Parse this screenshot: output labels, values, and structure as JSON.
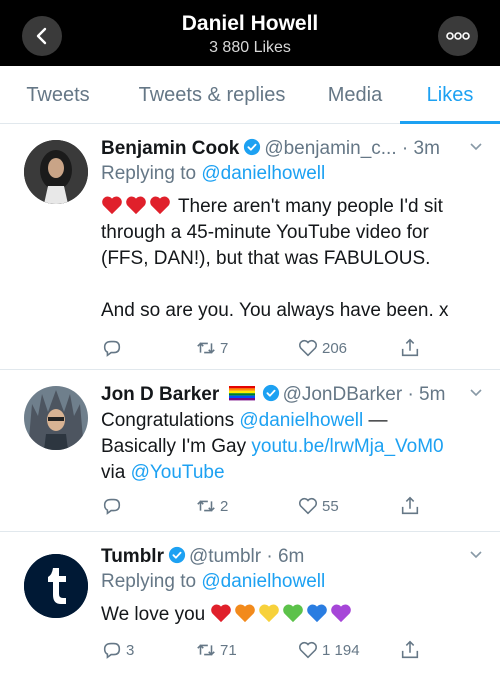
{
  "header": {
    "title": "Daniel Howell",
    "subtitle": "3 880 Likes",
    "back_icon": "chevron-left-icon",
    "more_icon": "more-dots-icon"
  },
  "tabs": [
    {
      "label": "Tweets",
      "active": false
    },
    {
      "label": "Tweets & replies",
      "active": false
    },
    {
      "label": "Media",
      "active": false
    },
    {
      "label": "Likes",
      "active": true
    }
  ],
  "colors": {
    "accent": "#1da1f2",
    "muted": "#657786",
    "heart_red": "#e0202b"
  },
  "tweets": [
    {
      "name": "Benjamin Cook",
      "handle": "@benjamin_c...",
      "time": "· 3m",
      "reply_prefix": "Replying to",
      "reply_to": "@danielhowell",
      "text_lines": [
        "There aren't many people I'd sit",
        "through a 45-minute YouTube video for",
        "(FFS, DAN!), but that was FABULOUS."
      ],
      "text_line2": "And so are you. You always have been. x",
      "retweets": "7",
      "likes": "206"
    },
    {
      "name": "Jon D Barker",
      "handle": "@JonDBarker",
      "time": "· 5m",
      "line1": "Congratulations",
      "mention": "@danielhowell",
      "dash": "—",
      "line2_prefix": "Basically I'm Gay",
      "link": "youtu.be/lrwMja_VoM0",
      "via": "via",
      "via_handle": "@YouTube",
      "retweets": "2",
      "likes": "55"
    },
    {
      "name": "Tumblr",
      "handle": "@tumblr",
      "time": "· 6m",
      "reply_prefix": "Replying to",
      "reply_to": "@danielhowell",
      "text": "We love you",
      "replies": "3",
      "retweets": "71",
      "likes": "1 194"
    }
  ]
}
